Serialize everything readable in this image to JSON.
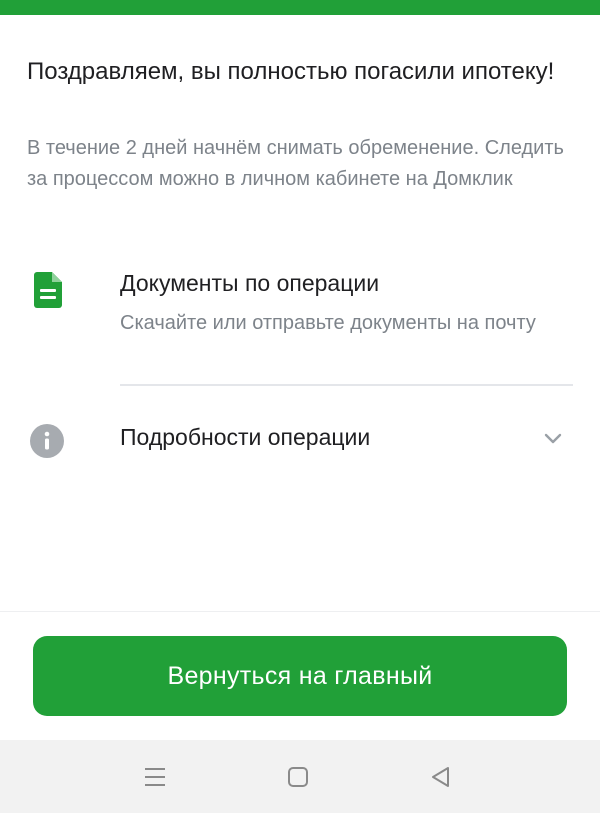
{
  "header": {
    "title": "Поздравляем, вы полностью погасили ипотеку!",
    "subtitle": "В течение 2 дней начнём снимать обременение. Следить за процессом можно в личном кабинете на Домклик"
  },
  "items": [
    {
      "icon": "document-icon",
      "title": "Документы по операции",
      "description": "Скачайте или отправьте документы на почту"
    },
    {
      "icon": "info-icon",
      "title": "Подробности операции",
      "action_icon": "chevron-down-icon"
    }
  ],
  "footer": {
    "main_button_label": "Вернуться на главный"
  },
  "nav_bar": {
    "buttons": [
      "menu-icon",
      "home-icon",
      "back-icon"
    ]
  },
  "colors": {
    "brand_green": "#21a038",
    "text_primary": "#1f1f22",
    "text_secondary": "#7d838a",
    "info_icon_gray": "#a7abb0",
    "divider": "#e4e6ea",
    "nav_bar_bg": "#f2f2f2"
  }
}
